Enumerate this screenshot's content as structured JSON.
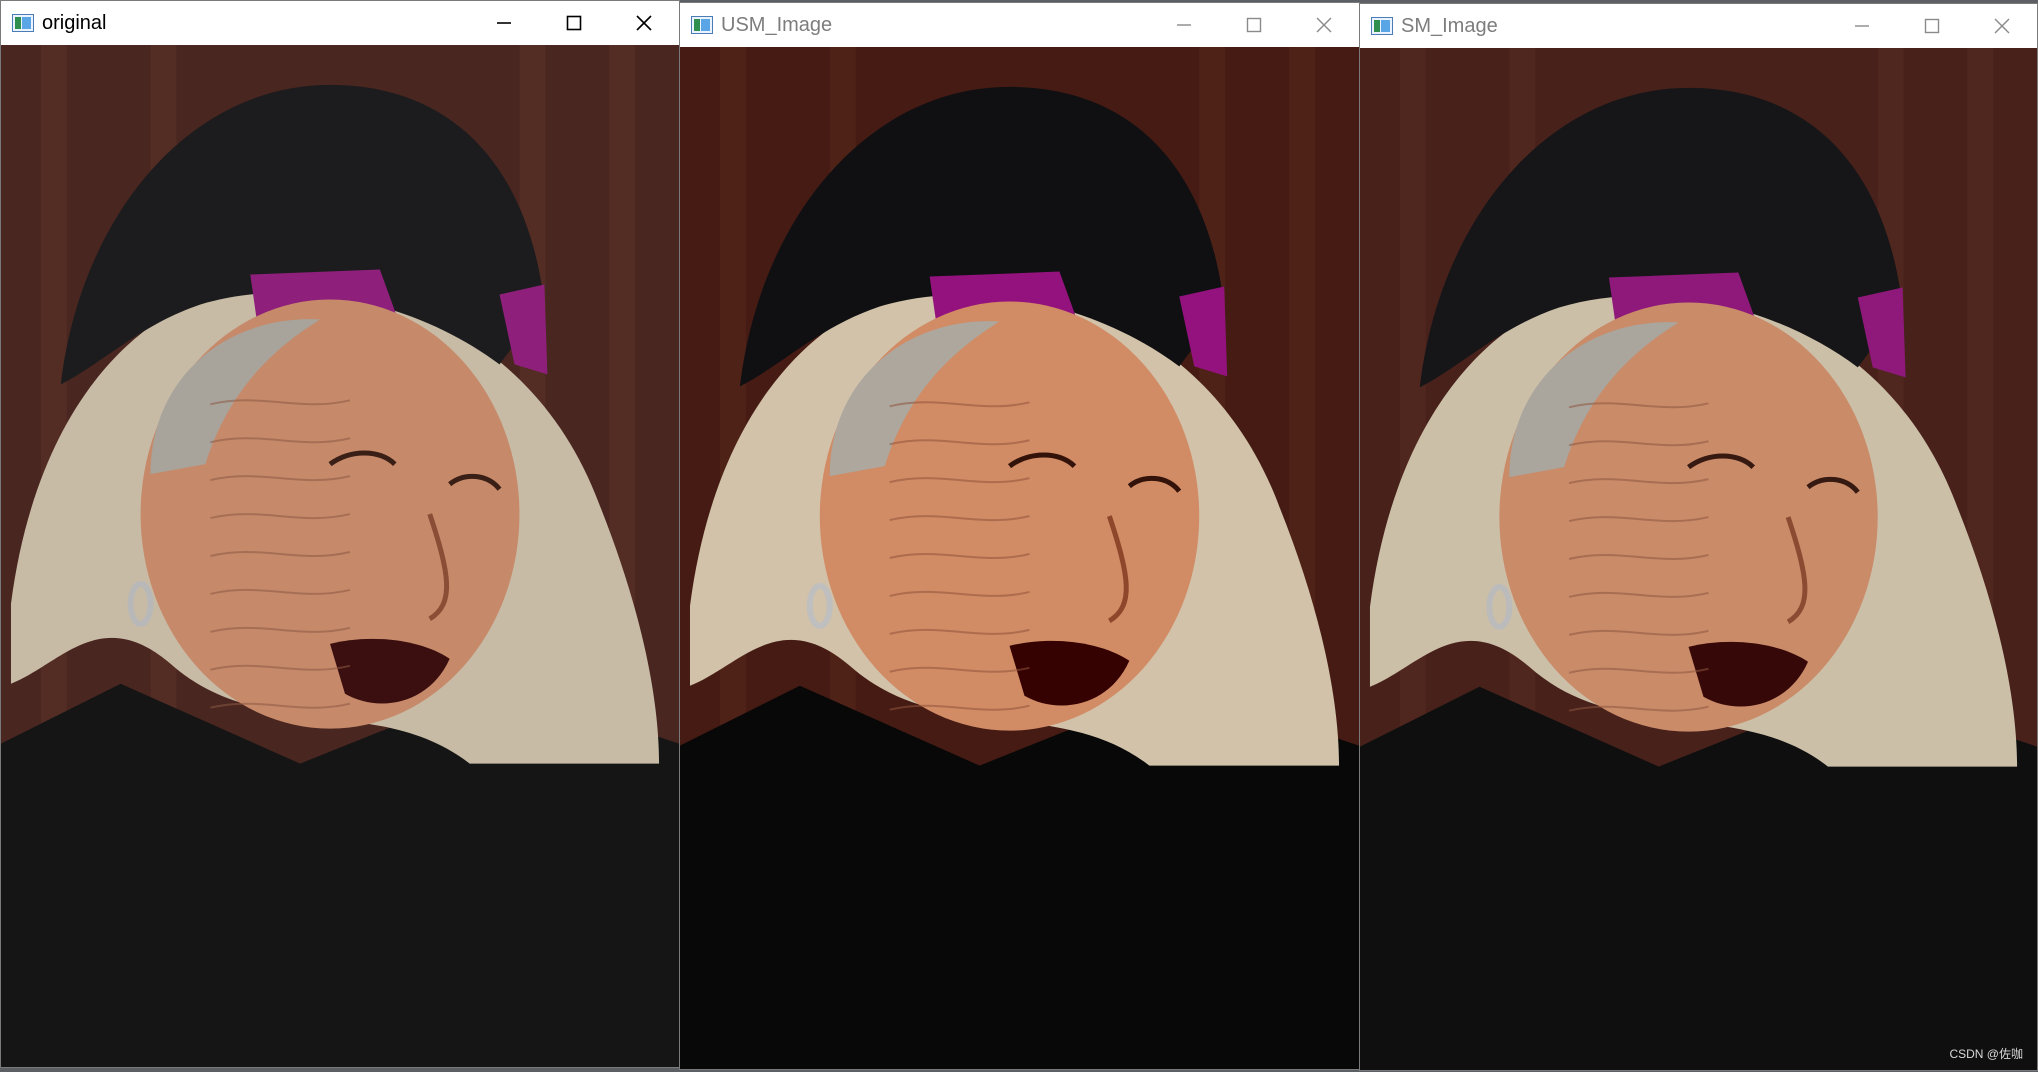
{
  "windows": [
    {
      "title": "original",
      "state": "active",
      "controls": {
        "minimize": "minimize-icon",
        "maximize": "maximize-icon",
        "close": "close-icon"
      }
    },
    {
      "title": "USM_Image",
      "state": "inactive",
      "controls": {
        "minimize": "minimize-icon",
        "maximize": "maximize-icon",
        "close": "close-icon"
      }
    },
    {
      "title": "SM_Image",
      "state": "inactive",
      "controls": {
        "minimize": "minimize-icon",
        "maximize": "maximize-icon",
        "close": "close-icon"
      }
    }
  ],
  "image_content": {
    "colors": {
      "background_wood": "#4a2620",
      "hat_black": "#1c1c1e",
      "band_magenta": "#8e1f7a",
      "hood_lining": "#c8bba6",
      "skin": "#c68a6a",
      "clothing": "#151515"
    }
  },
  "watermark": "CSDN @佐咖"
}
